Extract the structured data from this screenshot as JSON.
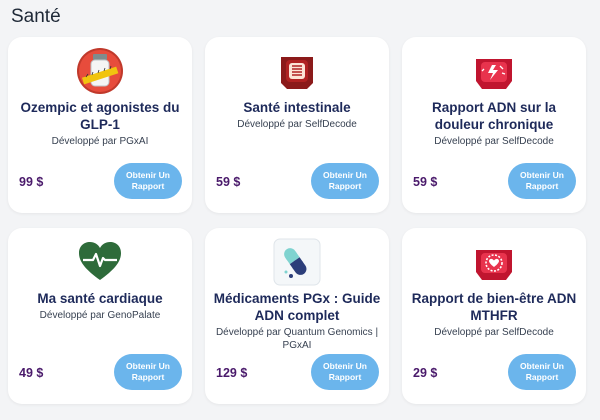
{
  "section": {
    "title": "Santé"
  },
  "products": [
    {
      "title": "Ozempic et agonistes du GLP-1",
      "developer": "Développé par PGxAI",
      "price": "99 $",
      "button": "Obtenir Un Rapport",
      "icon": "ozempic-vial-icon"
    },
    {
      "title": "Santé intestinale",
      "developer": "Développé par SelfDecode",
      "price": "59 $",
      "button": "Obtenir Un Rapport",
      "icon": "gut-health-icon"
    },
    {
      "title": "Rapport ADN sur la douleur chronique",
      "developer": "Développé par SelfDecode",
      "price": "59 $",
      "button": "Obtenir Un Rapport",
      "icon": "chronic-pain-icon"
    },
    {
      "title": "Ma santé cardiaque",
      "developer": "Développé par GenoPalate",
      "price": "49 $",
      "button": "Obtenir Un Rapport",
      "icon": "heart-health-icon"
    },
    {
      "title": "Médicaments PGx : Guide ADN complet",
      "developer": "Développé par Quantum Genomics | PGxAI",
      "price": "129 $",
      "button": "Obtenir Un Rapport",
      "icon": "pill-capsule-icon"
    },
    {
      "title": "Rapport de bien-être ADN MTHFR",
      "developer": "Développé par SelfDecode",
      "price": "29 $",
      "button": "Obtenir Un Rapport",
      "icon": "mthfr-wellness-icon"
    }
  ],
  "colors": {
    "button": "#6bb5ec",
    "price": "#4a1a6b",
    "title": "#1e2a5a",
    "background": "#f3f4f6"
  }
}
